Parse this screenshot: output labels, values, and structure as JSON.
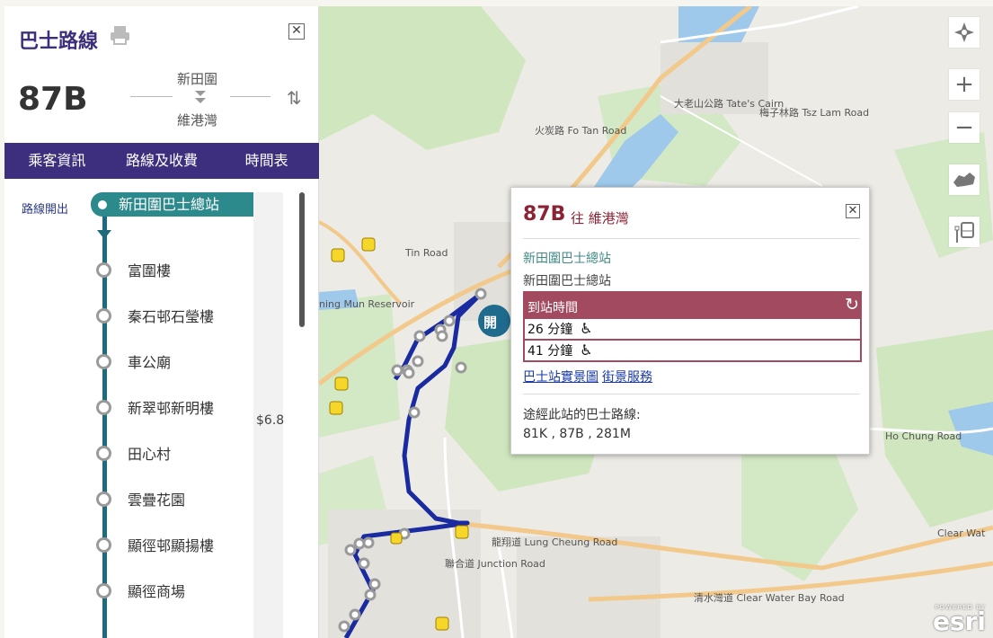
{
  "panel": {
    "title": "巴士路線",
    "close_symbol": "✕",
    "route_number": "87B",
    "origin": "新田圍",
    "destination": "維港灣",
    "swap_symbol": "⇅",
    "tabs": [
      {
        "label": "乘客資訊"
      },
      {
        "label": "路線及收費"
      },
      {
        "label": "時間表"
      }
    ],
    "route_start_label": "路線開出",
    "first_stop": "新田圍巴士總站",
    "fare": "$6.8",
    "stops": [
      "富圍樓",
      "秦石邨石瑩樓",
      "車公廟",
      "新翠邨新明樓",
      "田心村",
      "雲疊花園",
      "顯徑邨顯揚樓",
      "顯徑商場"
    ]
  },
  "popup": {
    "route": "87B",
    "direction": "往 維港灣",
    "close_symbol": "✕",
    "stop_name_link": "新田圍巴士總站",
    "stop_name": "新田圍巴士總站",
    "eta_header": "到站時間",
    "refresh_symbol": "↻",
    "etas": [
      {
        "time": "26 分鐘",
        "icon": "wheelchair-icon",
        "symbol": "♿"
      },
      {
        "time": "41 分鐘",
        "icon": "wheelchair-icon",
        "symbol": "♿"
      }
    ],
    "links": [
      "巴士站實景圖",
      "街景服務"
    ],
    "via_label": "途經此站的巴士路線:",
    "via_routes": "81K , 87B , 281M"
  },
  "map": {
    "labels": {
      "reservoir": "ning Mun Reservoir",
      "ho_chung": "Ho Chung Road",
      "lung_cheung": "龍翔道 Lung Cheung Road",
      "clear_water": "清水灣道 Clear Water Bay Road",
      "clear_wat": "Clear Wat",
      "junction": "聯合道 Junction Road",
      "fo_tan": "火炭路 Fo Tan Road",
      "tates": "大老山公路 Tate's Cairn",
      "tsz_lam": "梅子林路 Tsz Lam Road",
      "shing_mun": "Tin Road"
    },
    "controls": [
      "locate-icon",
      "zoom-in-icon",
      "zoom-out-icon",
      "basemap-icon",
      "bus-stop-icon"
    ],
    "control_symbols": {
      "zoom_in": "+",
      "zoom_out": "−"
    },
    "esri_powered": "POWERED BY",
    "esri_logo": "esri",
    "marker_label": "開"
  },
  "colors": {
    "purple": "#3d2f7e",
    "teal": "#2d8a8c",
    "route_line": "#1f6b7e",
    "popup_title": "#8a2434",
    "eta_bg": "#a24b60",
    "bus_route": "#1a2aa0"
  }
}
